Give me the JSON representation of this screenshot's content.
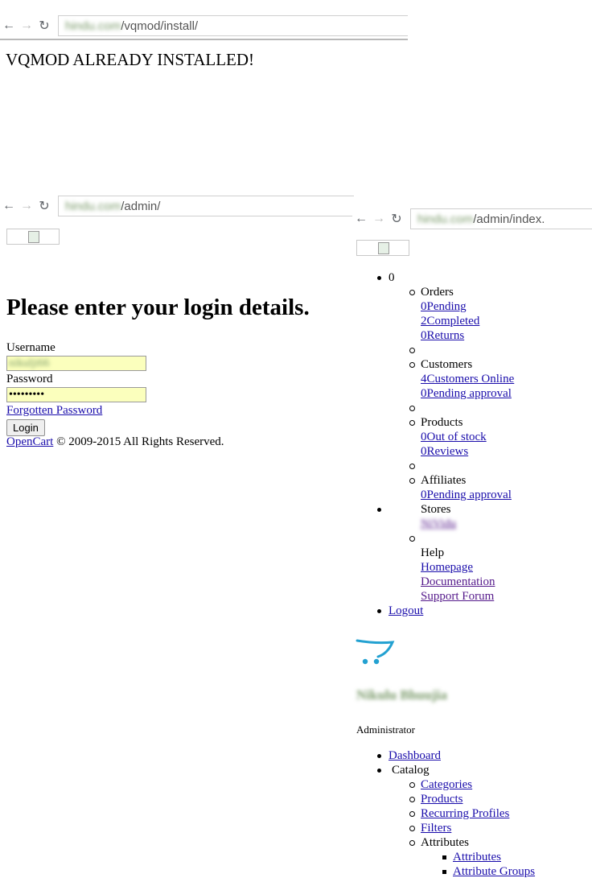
{
  "install_window": {
    "url_blurred": "hindu.com",
    "url_path": "/vqmod/install/",
    "message": "VQMOD ALREADY INSTALLED!"
  },
  "login_window": {
    "url_blurred": "hindu.com",
    "url_path": "/admin/",
    "heading": "Please enter your login details.",
    "username_label": "Username",
    "username_value": "nikulji66",
    "password_label": "Password",
    "password_value": "•••••••••",
    "forgot_link": "Forgotten Password",
    "login_button": "Login",
    "footer_link": "OpenCart",
    "footer_text": " © 2009-2015 All Rights Reserved."
  },
  "dashboard_window": {
    "url_blurred": "hindu.com",
    "url_path": "/admin/index.",
    "alerts_count": "0",
    "orders": {
      "title": "Orders",
      "links": [
        "0Pending",
        "2Completed",
        "0Returns"
      ]
    },
    "customers": {
      "title": "Customers",
      "links": [
        "4Customers Online",
        "0Pending approval"
      ]
    },
    "products": {
      "title": "Products",
      "links": [
        "0Out of stock",
        "0Reviews"
      ]
    },
    "affiliates": {
      "title": "Affiliates",
      "links": [
        "0Pending approval"
      ]
    },
    "stores": {
      "title": "Stores",
      "store_blurred": "NiVidu"
    },
    "help": {
      "title": "Help",
      "links": [
        "Homepage",
        "Documentation",
        "Support Forum"
      ]
    },
    "logout": "Logout",
    "user_name_blurred": "Nikulu Bhuujia",
    "user_role": "Administrator",
    "menu": {
      "dashboard": " Dashboard",
      "catalog": "Catalog",
      "catalog_items": [
        "Categories",
        "Products",
        "Recurring Profiles",
        "Filters"
      ],
      "attributes": "Attributes",
      "attribute_items": [
        "Attributes",
        "Attribute Groups"
      ]
    },
    "colors": {
      "cart_logo": "#23a1d1",
      "link": "#1a0dab",
      "visited": "#551a8b"
    }
  }
}
